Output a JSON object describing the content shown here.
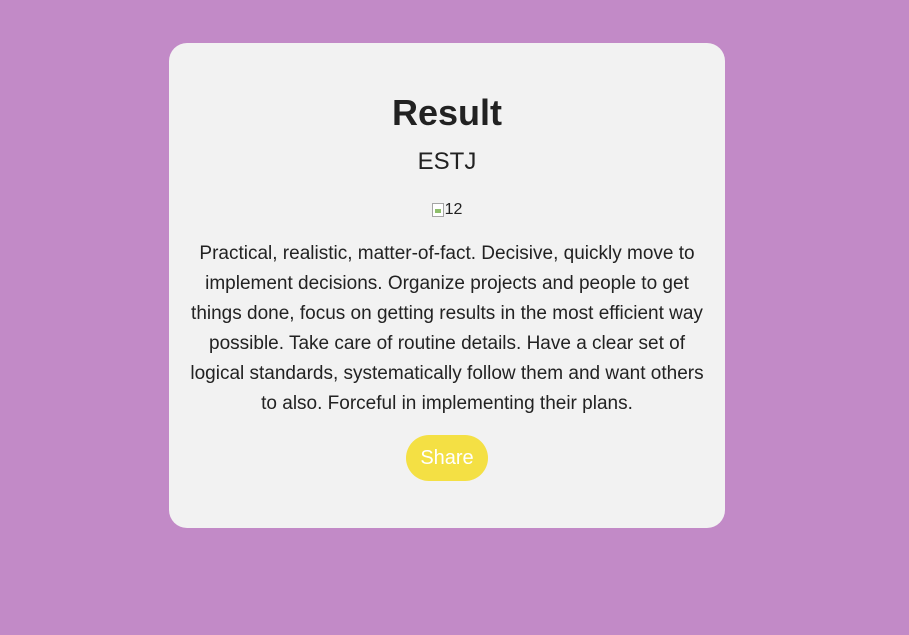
{
  "result": {
    "title": "Result",
    "type": "ESTJ",
    "image_alt": "12",
    "description": "Practical, realistic, matter-of-fact. Decisive, quickly move to implement decisions. Organize projects and people to get things done, focus on getting results in the most efficient way possible. Take care of routine details. Have a clear set of logical standards, systematically follow them and want others to also. Forceful in implementing their plans.",
    "share_label": "Share"
  },
  "colors": {
    "background": "#c28ac7",
    "card": "#f2f2f2",
    "share_button": "#f4e044",
    "text": "#222222"
  },
  "icons": {
    "image_placeholder": "broken-image-icon"
  }
}
